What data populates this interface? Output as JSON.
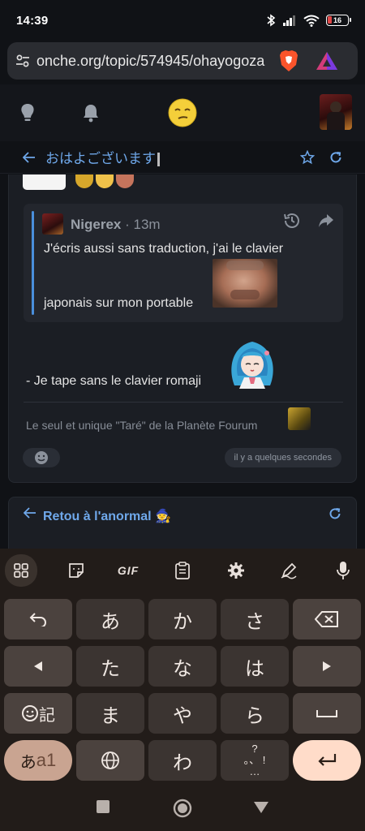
{
  "status_bar": {
    "time": "14:39",
    "battery": "16"
  },
  "browser": {
    "url": "onche.org/topic/574945/ohayogoza"
  },
  "topic": {
    "title": "おはよございます"
  },
  "post": {
    "quote": {
      "author": "Nigerex",
      "separator": "·",
      "time": "13m",
      "line1": "J'écris aussi sans traduction, j'ai le clavier",
      "line2": "japonais sur mon portable"
    },
    "body": "- Je tape sans le clavier romaji",
    "signature": "Le seul et unique \"Taré\" de la Planète Fourum",
    "timestamp": "il y a quelques secondes"
  },
  "next_topic": {
    "title": "Retou à l'anormal 🧙"
  },
  "keyboard": {
    "toolbar": {
      "gif": "GIF"
    },
    "rows": [
      [
        "あ",
        "か",
        "さ"
      ],
      [
        "た",
        "な",
        "は"
      ],
      [
        "ま",
        "や",
        "ら"
      ],
      [
        "わ",
        "゛゜",
        "?!"
      ]
    ],
    "special": {
      "emoji_kanji": "記",
      "mode_a": "あ",
      "mode_latin": "a1",
      "punct_top": "?",
      "punct_mid": "。、 !",
      "punct_bottom": "…"
    }
  },
  "colors": {
    "accent": "#6fa8ea",
    "quote_bar": "#4a8fdc",
    "enter_key": "#ffdcc9",
    "mode_key": "#c9a491"
  }
}
